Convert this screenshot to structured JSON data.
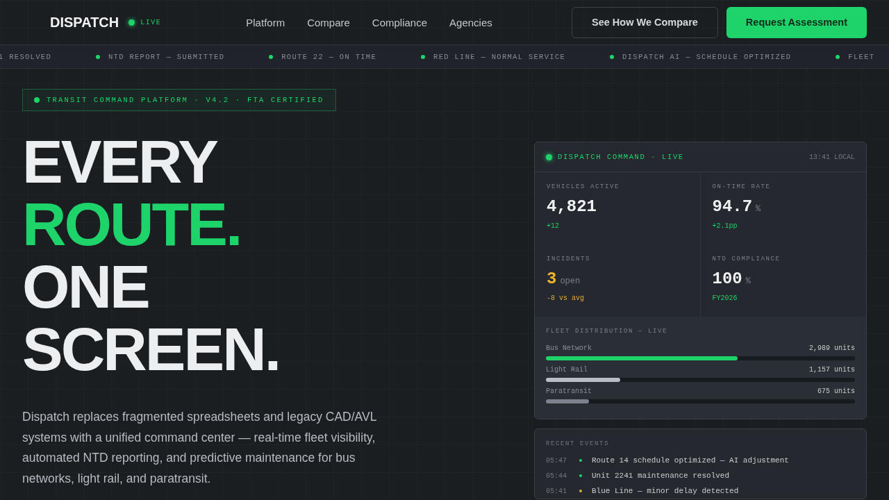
{
  "nav": {
    "brand": "DISPATCH",
    "status": "LIVE",
    "links": [
      "Platform",
      "Compare",
      "Compliance",
      "Agencies"
    ],
    "secondary_button": "See How We Compare",
    "primary_button": "Request Assessment"
  },
  "ticker": [
    {
      "text": "1 RESOLVED",
      "dot": false
    },
    {
      "text": "NTD REPORT — SUBMITTED",
      "dot": true
    },
    {
      "text": "ROUTE 22 — ON TIME",
      "dot": true
    },
    {
      "text": "RED LINE — NORMAL SERVICE",
      "dot": true
    },
    {
      "text": "DISPATCH AI — SCHEDULE OPTIMIZED",
      "dot": true
    },
    {
      "text": "FLEET",
      "dot": true
    }
  ],
  "hero": {
    "badge": "TRANSIT COMMAND PLATFORM · V4.2 · FTA CERTIFIED",
    "headline": [
      {
        "text": "EVERY",
        "accent": false
      },
      {
        "text": "ROUTE.",
        "accent": true
      },
      {
        "text": "ONE",
        "accent": false
      },
      {
        "text": "SCREEN.",
        "accent": false
      }
    ],
    "description": "Dispatch replaces fragmented spreadsheets and legacy CAD/AVL systems with a unified command center — real-time fleet visibility, automated NTD reporting, and predictive maintenance for bus networks, light rail, and paratransit."
  },
  "command_panel": {
    "title": "DISPATCH COMMAND · LIVE",
    "time": "13:41 LOCAL",
    "stats": [
      {
        "label": "VEHICLES ACTIVE",
        "value": "4,821",
        "delta": "+12",
        "warning": false
      },
      {
        "label": "ON-TIME RATE",
        "value": "94.7",
        "unit": "%",
        "delta": "+2.1pp",
        "warning": false
      },
      {
        "label": "INCIDENTS",
        "value": "3",
        "unit": "open",
        "delta": "-8 vs avg",
        "warning": true
      },
      {
        "label": "NTD COMPLIANCE",
        "value": "100",
        "unit": "%",
        "delta": "FY2026",
        "warning": false
      }
    ],
    "fleet_title": "FLEET DISTRIBUTION — LIVE",
    "fleet": [
      {
        "name": "Bus Network",
        "units": "2,989 units",
        "level": 0.62,
        "color": "#1ed36a"
      },
      {
        "name": "Light Rail",
        "units": "1,157 units",
        "level": 0.24,
        "color": "#b9bec6"
      },
      {
        "name": "Paratransit",
        "units": "675 units",
        "level": 0.14,
        "color": "#7d838c"
      }
    ]
  },
  "events": {
    "title": "RECENT EVENTS",
    "items": [
      {
        "time": "05:47",
        "text": "Route 14 schedule optimized — AI adjustment",
        "color": "#1ed36a"
      },
      {
        "time": "05:44",
        "text": "Unit 2241 maintenance resolved",
        "color": "#1ed36a"
      },
      {
        "time": "05:41",
        "text": "Blue Line — minor delay detected",
        "color": "#c9b23a"
      }
    ]
  }
}
